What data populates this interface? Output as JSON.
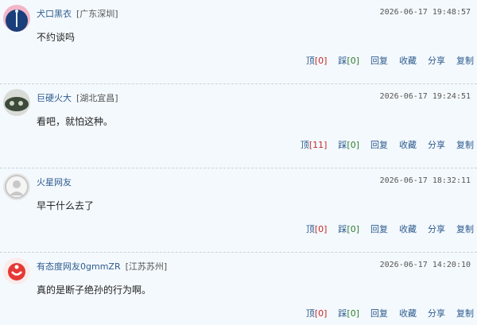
{
  "colors": {
    "username": "#2d5b8f",
    "up_count": "#c62828",
    "down_count": "#2e7d32"
  },
  "comments": [
    {
      "avatar_icon": "fisher-avatar-icon",
      "username": "犬口黑衣",
      "location": "[广东深圳]",
      "time": "2026-06-17 19:48:57",
      "content": "不约谈吗",
      "up_label": "顶",
      "up_count": "[0]",
      "down_label": "踩",
      "down_count": "[0]",
      "reply_label": "回复",
      "collect_label": "收藏",
      "share_label": "分享",
      "copy_label": "复制"
    },
    {
      "avatar_icon": "photo-avatar-icon",
      "username": "巨硬火大",
      "location": "[湖北宜昌]",
      "time": "2026-06-17 19:24:51",
      "content": "看吧，就怕这种。",
      "up_label": "顶",
      "up_count": "[11]",
      "down_label": "踩",
      "down_count": "[0]",
      "reply_label": "回复",
      "collect_label": "收藏",
      "share_label": "分享",
      "copy_label": "复制"
    },
    {
      "avatar_icon": "default-user-avatar-icon",
      "username": "火星网友",
      "location": "",
      "time": "2026-06-17 18:32:11",
      "content": "早干什么去了",
      "up_label": "顶",
      "up_count": "[0]",
      "down_label": "踩",
      "down_count": "[0]",
      "reply_label": "回复",
      "collect_label": "收藏",
      "share_label": "分享",
      "copy_label": "复制"
    },
    {
      "avatar_icon": "red-logo-avatar-icon",
      "username": "有态度网友0gmmZR",
      "location": "[江苏苏州]",
      "time": "2026-06-17 14:20:10",
      "content": "真的是断子绝孙的行为啊。",
      "up_label": "顶",
      "up_count": "[0]",
      "down_label": "踩",
      "down_count": "[0]",
      "reply_label": "回复",
      "collect_label": "收藏",
      "share_label": "分享",
      "copy_label": "复制"
    }
  ]
}
